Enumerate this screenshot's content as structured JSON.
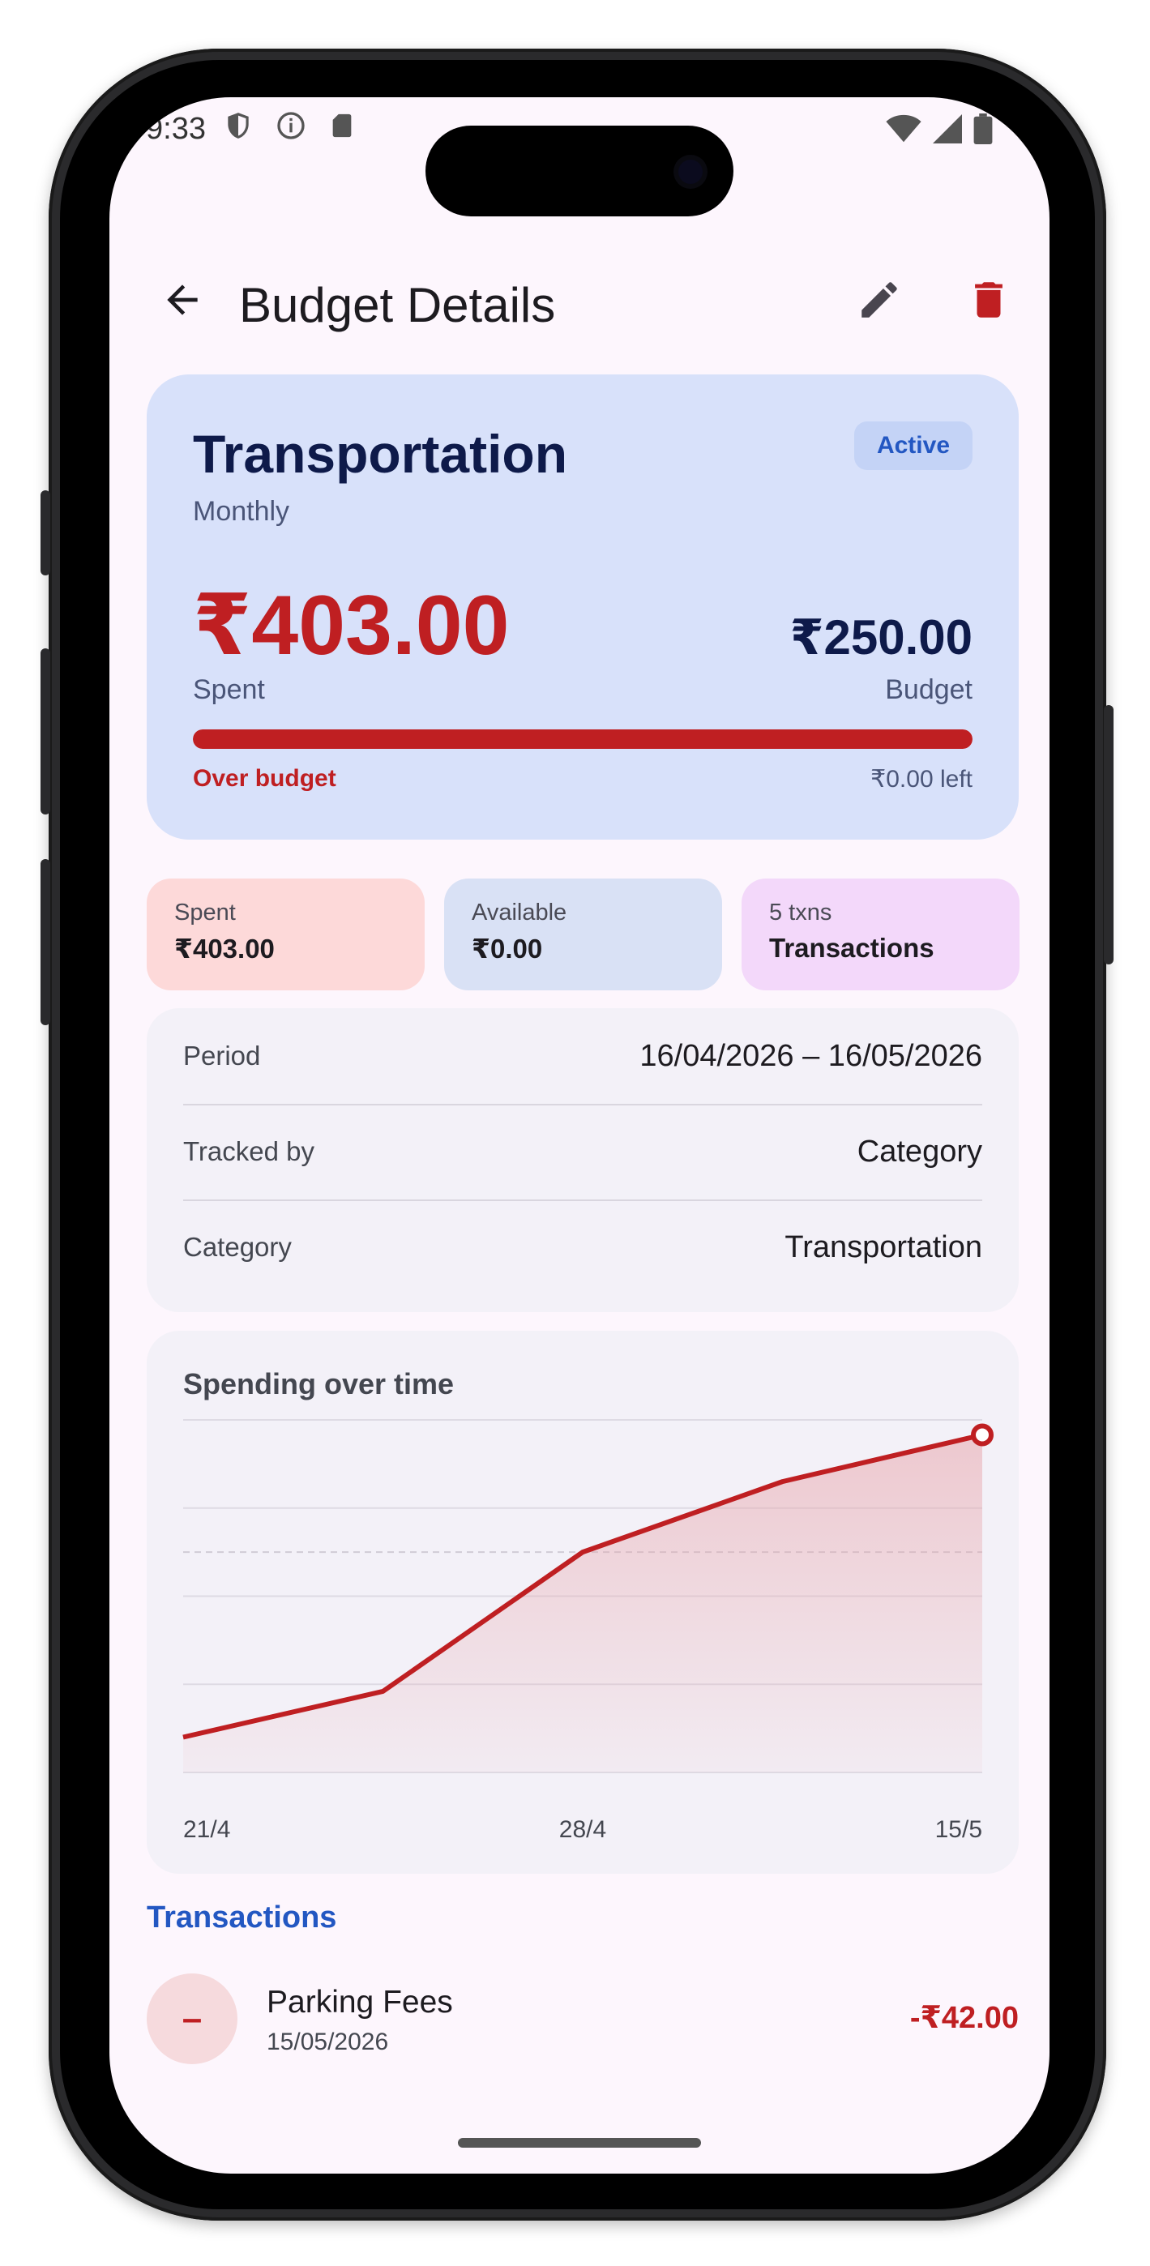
{
  "status_bar": {
    "time": "9:33"
  },
  "app_bar": {
    "title": "Budget Details"
  },
  "hero": {
    "name": "Transportation",
    "period_type": "Monthly",
    "status": "Active",
    "spent": "₹403.00",
    "spent_label": "Spent",
    "budget": "₹250.00",
    "budget_label": "Budget",
    "progress_fraction": 1.0,
    "over_label": "Over budget",
    "left_label": "₹0.00 left"
  },
  "chips": [
    {
      "label": "Spent",
      "value": "₹403.00"
    },
    {
      "label": "Available",
      "value": "₹0.00"
    },
    {
      "label": "5 txns",
      "value": "Transactions"
    }
  ],
  "details": [
    {
      "label": "Period",
      "value": "16/04/2026 – 16/05/2026"
    },
    {
      "label": "Tracked by",
      "value": "Category"
    },
    {
      "label": "Category",
      "value": "Transportation"
    }
  ],
  "chart_data": {
    "type": "area",
    "title": "Spending over time",
    "x_tick_labels": [
      "21/4",
      "28/4",
      "15/5"
    ],
    "values": [
      40,
      92,
      250,
      330,
      383
    ],
    "ylim": [
      0,
      400
    ],
    "reference_line": 250,
    "grid": true,
    "colors": {
      "line": "#bf1f22",
      "fill": "#e8a7ad"
    }
  },
  "transactions": {
    "header": "Transactions",
    "items": [
      {
        "name": "Parking Fees",
        "date": "15/05/2026",
        "amount": "-₹42.00",
        "icon": "minus"
      }
    ]
  },
  "colors": {
    "accent": "#2357c2",
    "danger": "#bf1f22",
    "hero_bg": "#d8e1fa"
  }
}
